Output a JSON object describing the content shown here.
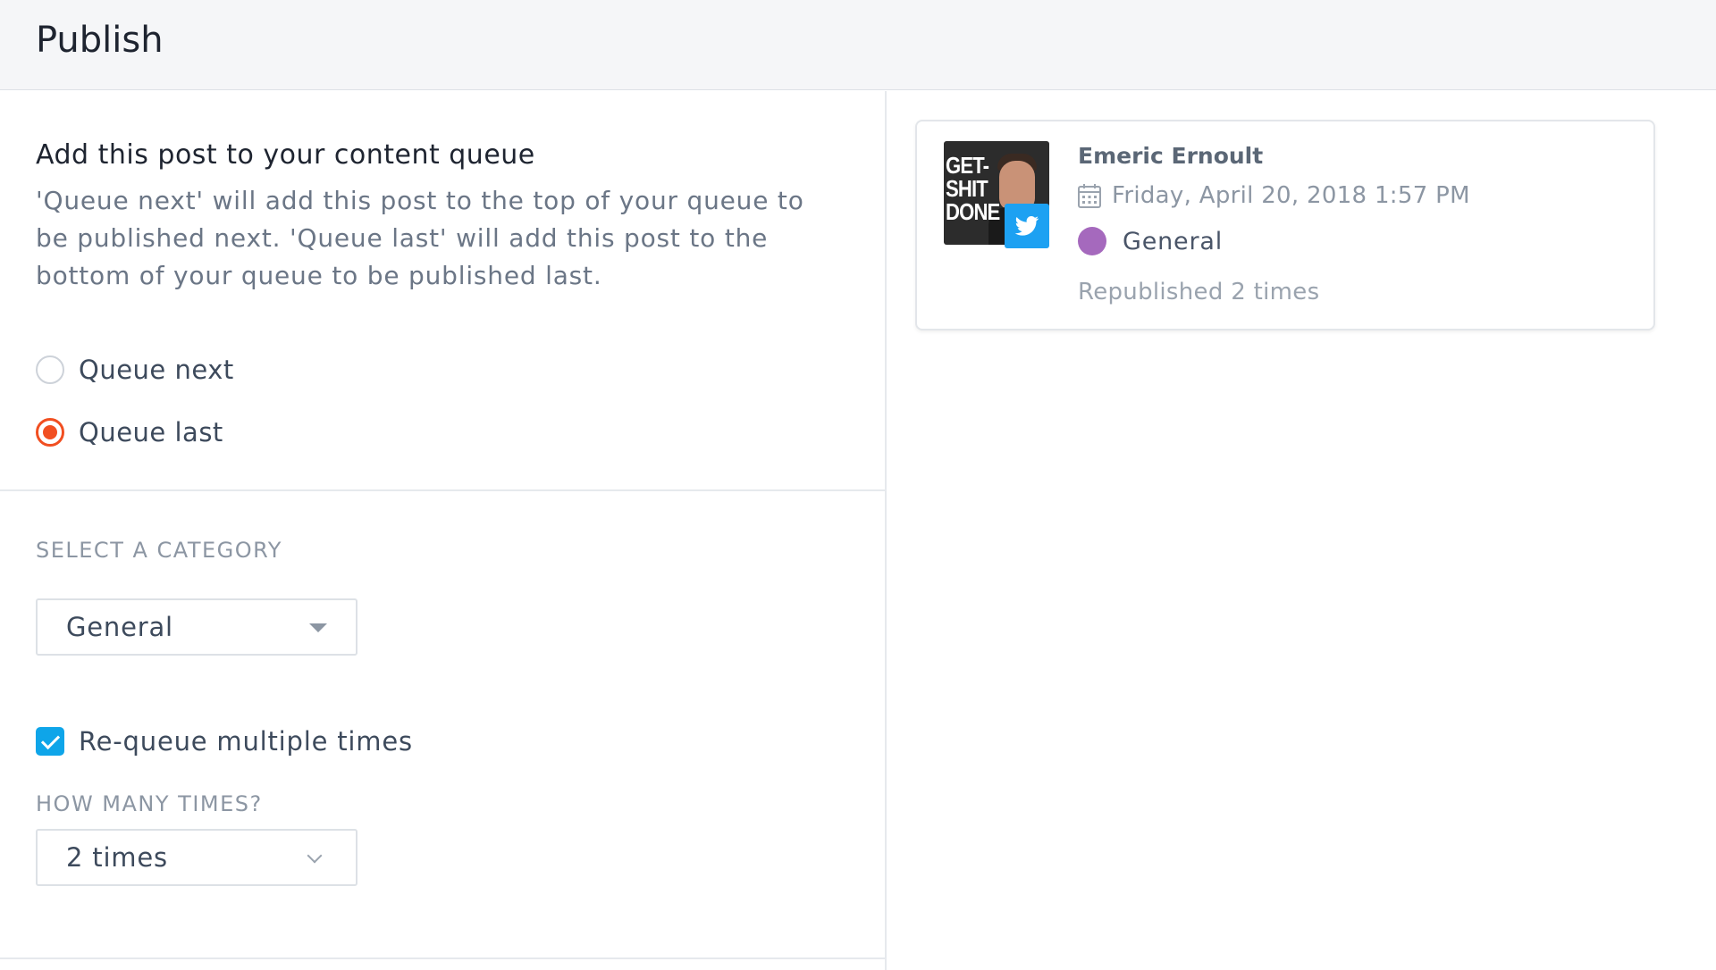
{
  "header": {
    "title": "Publish"
  },
  "queue": {
    "title": "Add this post to your content queue",
    "description": "'Queue next' will add this post to the top of your queue to be published next. 'Queue last' will add this post to the bottom of your queue to be published last.",
    "options": [
      {
        "label": "Queue next",
        "selected": false
      },
      {
        "label": "Queue last",
        "selected": true
      }
    ]
  },
  "category": {
    "label": "SELECT A CATEGORY",
    "selected": "General"
  },
  "requeue": {
    "label": "Re-queue multiple times",
    "checked": true,
    "times_label": "HOW MANY TIMES?",
    "times_selected": "2 times"
  },
  "post_card": {
    "author": "Emeric Ernoult",
    "date": "Friday, April 20, 2018 1:57 PM",
    "category": "General",
    "republished": "Republished 2 times",
    "avatar_text_lines": [
      "GET-",
      "SHIT",
      "DONE"
    ],
    "network_icon": "twitter-icon"
  },
  "colors": {
    "accent_radio": "#f14f21",
    "checkbox": "#0ea5e9",
    "category_dot": "#a569bd",
    "twitter": "#1da1f2"
  }
}
